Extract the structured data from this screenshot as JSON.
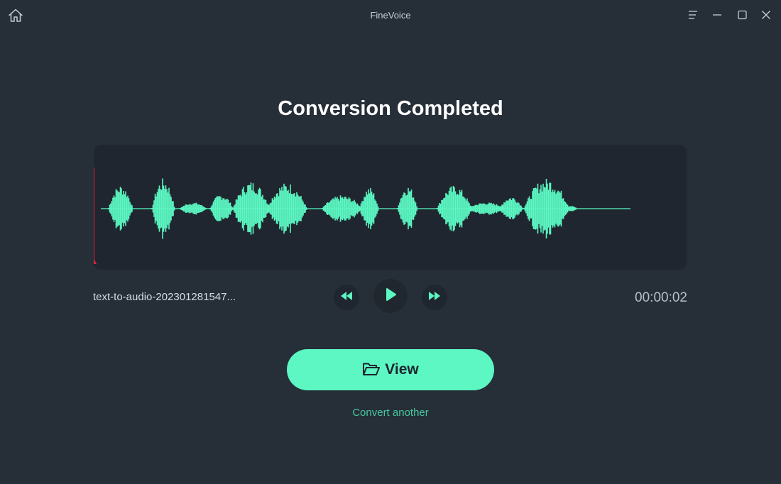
{
  "window": {
    "title": "FineVoice",
    "home_icon": "home-icon",
    "menu_icon": "menu-icon",
    "minimize_icon": "minimize-icon",
    "maximize_icon": "maximize-icon",
    "close_icon": "close-icon"
  },
  "main": {
    "heading": "Conversion Completed"
  },
  "player": {
    "file_name": "text-to-audio-202301281547...",
    "duration": "00:00:02",
    "playhead_progress": 0.0,
    "controls": {
      "rewind_icon": "rewind-icon",
      "play_icon": "play-icon",
      "forward_icon": "fast-forward-icon"
    }
  },
  "actions": {
    "view_label": "View",
    "view_icon": "folder-open-icon",
    "convert_another_label": "Convert another"
  },
  "colors": {
    "background": "#262e38",
    "panel": "#1f262f",
    "accent": "#5cf7c2",
    "accent_text": "#45c99d",
    "playhead": "#e0213a"
  }
}
